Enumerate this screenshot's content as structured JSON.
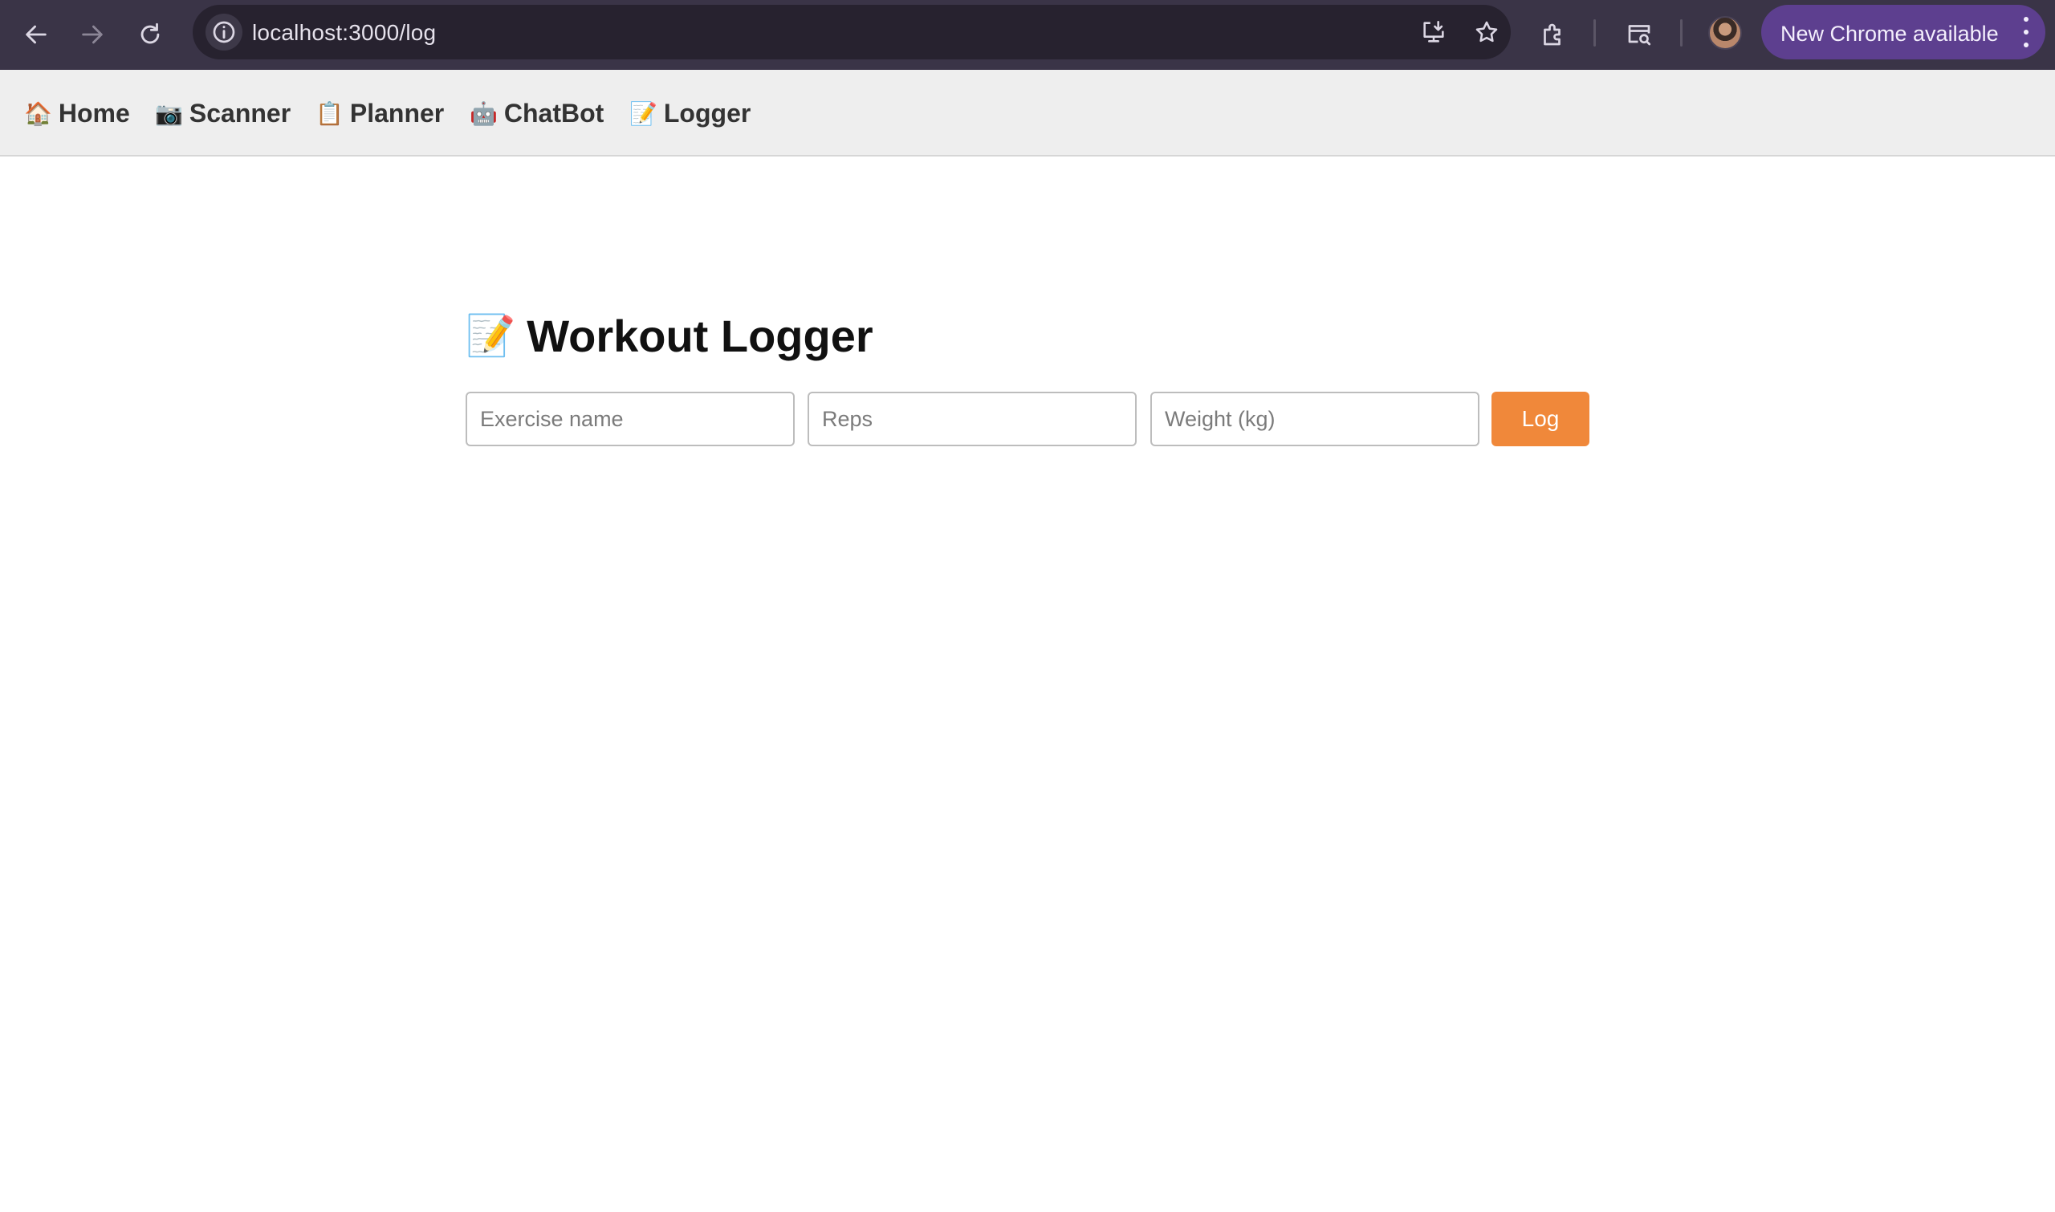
{
  "browser": {
    "url": "localhost:3000/log",
    "update_label": "New Chrome available",
    "icons": {
      "back": "arrow-left-icon",
      "forward": "arrow-right-icon",
      "reload": "reload-icon",
      "site_info": "info-icon",
      "install": "install-app-icon",
      "bookmark": "star-icon",
      "extensions": "puzzle-icon",
      "lens": "search-tab-icon",
      "menu": "kebab-menu-icon"
    },
    "colors": {
      "toolbar": "#3a3447",
      "omnibox": "#27222f",
      "update_pill": "#5d3f8f"
    }
  },
  "app_nav": {
    "items": [
      {
        "emoji": "🏠",
        "label": "Home"
      },
      {
        "emoji": "📷",
        "label": "Scanner"
      },
      {
        "emoji": "📋",
        "label": "Planner"
      },
      {
        "emoji": "🤖",
        "label": "ChatBot"
      },
      {
        "emoji": "📝",
        "label": "Logger"
      }
    ]
  },
  "main": {
    "title_emoji": "📝",
    "title": "Workout Logger",
    "form": {
      "exercise_placeholder": "Exercise name",
      "reps_placeholder": "Reps",
      "weight_placeholder": "Weight (kg)",
      "submit_label": "Log"
    },
    "colors": {
      "accent": "#f0883a"
    }
  }
}
